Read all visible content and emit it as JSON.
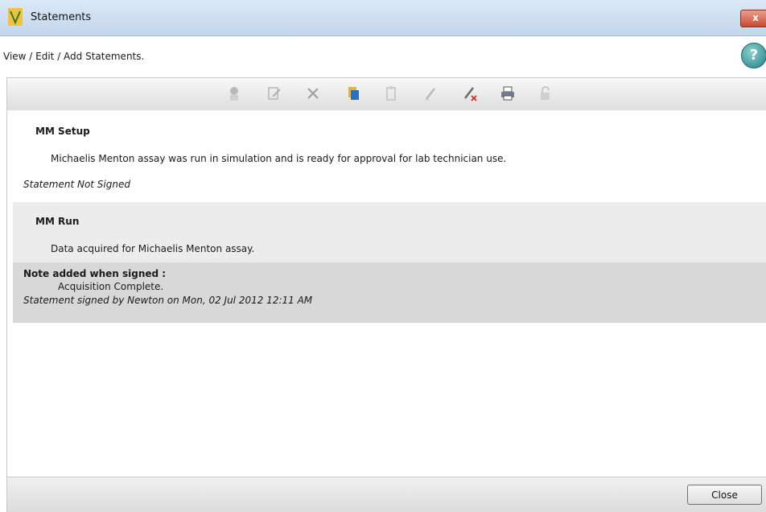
{
  "window": {
    "title": "Statements",
    "close_glyph": "x"
  },
  "header": {
    "subtitle": "View / Edit / Add Statements.",
    "help_glyph": "?"
  },
  "toolbar": {
    "icons": [
      "sign-icon",
      "edit-icon",
      "delete-icon",
      "copy-icon",
      "paste-icon",
      "pen-icon",
      "pen-delete-icon",
      "print-icon",
      "unlock-icon"
    ]
  },
  "statements": [
    {
      "title": "MM Setup",
      "body": "Michaelis Menton assay was run in simulation and is ready for approval for lab technician use.",
      "status": "Statement Not Signed"
    },
    {
      "title": "MM Run",
      "body": "Data acquired for Michaelis Menton assay.",
      "note_label": "Note added when signed :",
      "note_text": "Acquisition Complete.",
      "status": "Statement signed by Newton on Mon, 02 Jul 2012 12:11 AM"
    }
  ],
  "footer": {
    "close_label": "Close"
  },
  "colors": {
    "titlebar": "#c3d6ec",
    "selected_statement": "#ececec",
    "signed_note": "#d8d8d8"
  }
}
